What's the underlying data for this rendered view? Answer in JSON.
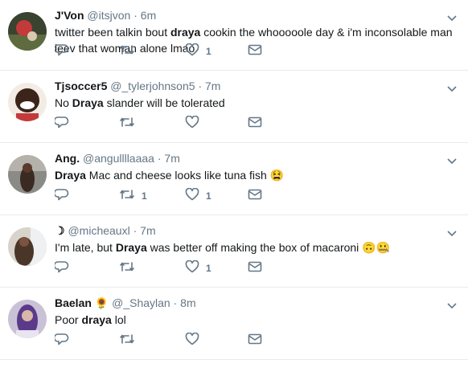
{
  "tweets": [
    {
      "name": "J'Von",
      "handle": "@itsjvon",
      "time": "6m",
      "text_before": "twitter been talkin bout ",
      "bold": "draya",
      "text_after": " cookin the whooooole day & i'm inconsolable man leev that woman alone lmao",
      "retweets": "",
      "likes": "1"
    },
    {
      "name": "Tjsoccer5",
      "handle": "@_tylerjohnson5",
      "time": "7m",
      "text_before": "No ",
      "bold": "Draya",
      "text_after": " slander will be tolerated",
      "retweets": "",
      "likes": ""
    },
    {
      "name": "Ang.",
      "handle": "@angullllaaaa",
      "time": "7m",
      "text_before": "",
      "bold": "Draya",
      "text_after": " Mac and cheese looks like tuna fish 😫",
      "retweets": "1",
      "likes": "1"
    },
    {
      "name": "☽",
      "handle": "@micheauxl",
      "time": "7m",
      "text_before": "I'm late, but ",
      "bold": "Draya",
      "text_after": " was better off making the box of macaroni 🙃🤐",
      "retweets": "",
      "likes": "1"
    },
    {
      "name": "Baelan 🌻",
      "handle": "@_Shaylan",
      "time": "8m",
      "text_before": "Poor ",
      "bold": "draya",
      "text_after": " lol",
      "retweets": "",
      "likes": ""
    }
  ],
  "separator": "·",
  "icons": {
    "reply": "reply-icon",
    "retweet": "retweet-icon",
    "like": "heart-icon",
    "dm": "direct-message-icon",
    "more": "chevron-down-icon"
  },
  "colors": {
    "text": "#14171a",
    "secondary": "#657786",
    "divider": "#e6ecf0"
  }
}
